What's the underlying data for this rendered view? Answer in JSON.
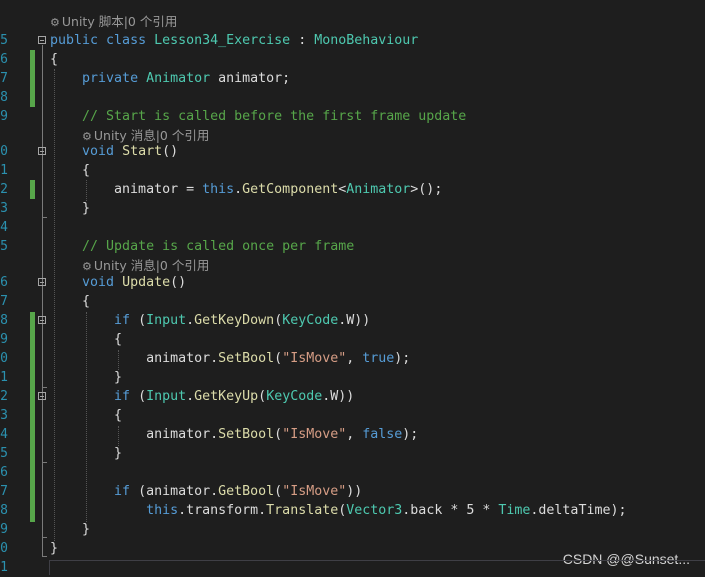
{
  "editor": {
    "lines": [
      {
        "num": "",
        "lens": "Unity 脚本|0 个引用",
        "code": []
      },
      {
        "num": "5",
        "code": [
          [
            "kw",
            "public "
          ],
          [
            "kw",
            "class "
          ],
          [
            "ty",
            "Lesson34_Exercise"
          ],
          [
            "pl",
            " : "
          ],
          [
            "ty",
            "MonoBehaviour"
          ]
        ]
      },
      {
        "num": "6",
        "code": [
          [
            "pl",
            "{"
          ]
        ]
      },
      {
        "num": "7",
        "code": [
          [
            "pl",
            "    "
          ],
          [
            "kw",
            "private "
          ],
          [
            "ty",
            "Animator"
          ],
          [
            "pl",
            " animator;"
          ]
        ]
      },
      {
        "num": "8",
        "code": []
      },
      {
        "num": "9",
        "code": [
          [
            "pl",
            "    "
          ],
          [
            "cm",
            "// Start is called before the first frame update"
          ]
        ]
      },
      {
        "num": "",
        "lens": "Unity 消息|0 个引用",
        "code": []
      },
      {
        "num": "0",
        "code": [
          [
            "pl",
            "    "
          ],
          [
            "kw",
            "void "
          ],
          [
            "fn",
            "Start"
          ],
          [
            "pl",
            "()"
          ]
        ]
      },
      {
        "num": "1",
        "code": [
          [
            "pl",
            "    {"
          ]
        ]
      },
      {
        "num": "2",
        "code": [
          [
            "pl",
            "        animator = "
          ],
          [
            "kw",
            "this"
          ],
          [
            "pl",
            "."
          ],
          [
            "fn",
            "GetComponent"
          ],
          [
            "pl",
            "<"
          ],
          [
            "ty",
            "Animator"
          ],
          [
            "pl",
            ">();"
          ]
        ]
      },
      {
        "num": "3",
        "code": [
          [
            "pl",
            "    }"
          ]
        ]
      },
      {
        "num": "4",
        "code": []
      },
      {
        "num": "5",
        "code": [
          [
            "pl",
            "    "
          ],
          [
            "cm",
            "// Update is called once per frame"
          ]
        ]
      },
      {
        "num": "",
        "lens": "Unity 消息|0 个引用",
        "code": []
      },
      {
        "num": "6",
        "code": [
          [
            "pl",
            "    "
          ],
          [
            "kw",
            "void "
          ],
          [
            "fn",
            "Update"
          ],
          [
            "pl",
            "()"
          ]
        ]
      },
      {
        "num": "7",
        "code": [
          [
            "pl",
            "    {"
          ]
        ]
      },
      {
        "num": "8",
        "code": [
          [
            "pl",
            "        "
          ],
          [
            "kw",
            "if"
          ],
          [
            "pl",
            " ("
          ],
          [
            "ty",
            "Input"
          ],
          [
            "pl",
            "."
          ],
          [
            "fn",
            "GetKeyDown"
          ],
          [
            "pl",
            "("
          ],
          [
            "ty",
            "KeyCode"
          ],
          [
            "pl",
            ".W))"
          ]
        ]
      },
      {
        "num": "9",
        "code": [
          [
            "pl",
            "        {"
          ]
        ]
      },
      {
        "num": "0",
        "code": [
          [
            "pl",
            "            animator."
          ],
          [
            "fn",
            "SetBool"
          ],
          [
            "pl",
            "("
          ],
          [
            "st",
            "\"IsMove\""
          ],
          [
            "pl",
            ", "
          ],
          [
            "kw",
            "true"
          ],
          [
            "pl",
            ");"
          ]
        ]
      },
      {
        "num": "1",
        "code": [
          [
            "pl",
            "        }"
          ]
        ]
      },
      {
        "num": "2",
        "code": [
          [
            "pl",
            "        "
          ],
          [
            "kw",
            "if"
          ],
          [
            "pl",
            " ("
          ],
          [
            "ty",
            "Input"
          ],
          [
            "pl",
            "."
          ],
          [
            "fn",
            "GetKeyUp"
          ],
          [
            "pl",
            "("
          ],
          [
            "ty",
            "KeyCode"
          ],
          [
            "pl",
            ".W))"
          ]
        ]
      },
      {
        "num": "3",
        "code": [
          [
            "pl",
            "        {"
          ]
        ]
      },
      {
        "num": "4",
        "code": [
          [
            "pl",
            "            animator."
          ],
          [
            "fn",
            "SetBool"
          ],
          [
            "pl",
            "("
          ],
          [
            "st",
            "\"IsMove\""
          ],
          [
            "pl",
            ", "
          ],
          [
            "kw",
            "false"
          ],
          [
            "pl",
            ");"
          ]
        ]
      },
      {
        "num": "5",
        "code": [
          [
            "pl",
            "        }"
          ]
        ]
      },
      {
        "num": "6",
        "code": []
      },
      {
        "num": "7",
        "code": [
          [
            "pl",
            "        "
          ],
          [
            "kw",
            "if"
          ],
          [
            "pl",
            " (animator."
          ],
          [
            "fn",
            "GetBool"
          ],
          [
            "pl",
            "("
          ],
          [
            "st",
            "\"IsMove\""
          ],
          [
            "pl",
            "))"
          ]
        ]
      },
      {
        "num": "8",
        "code": [
          [
            "pl",
            "            "
          ],
          [
            "kw",
            "this"
          ],
          [
            "pl",
            ".transform."
          ],
          [
            "fn",
            "Translate"
          ],
          [
            "pl",
            "("
          ],
          [
            "ty",
            "Vector3"
          ],
          [
            "pl",
            ".back * 5 * "
          ],
          [
            "ty",
            "Time"
          ],
          [
            "pl",
            ".deltaTime);"
          ]
        ]
      },
      {
        "num": "9",
        "code": [
          [
            "pl",
            "    }"
          ]
        ]
      },
      {
        "num": "0",
        "code": [
          [
            "pl",
            "}"
          ]
        ]
      },
      {
        "num": "1",
        "code": []
      }
    ]
  },
  "colors": {
    "background": "#1e1e1e",
    "keyword": "#569cd6",
    "type": "#4ec9b0",
    "method": "#dcdcaa",
    "string": "#d69d85",
    "comment": "#57a64a",
    "plain": "#dcdcdc",
    "line_number": "#2b91af",
    "change_bar": "#57a64a"
  },
  "icons": {
    "code_lens": "unity-gear-icon",
    "fold": "collapse-minus-icon"
  },
  "watermark": "CSDN @@Sunset..."
}
